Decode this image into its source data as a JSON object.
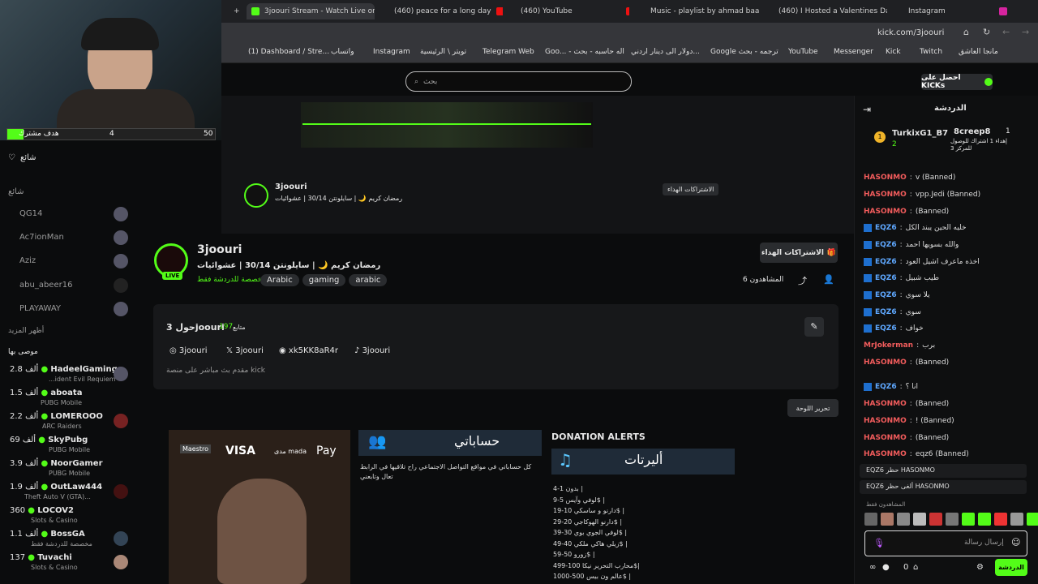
{
  "browser": {
    "tabs": [
      {
        "label": "3joouri Stream - Watch Live on"
      },
      {
        "label": "(460) peace for a long day"
      },
      {
        "label": "(460) YouTube"
      },
      {
        "label": "Music - playlist by ahmad baa"
      },
      {
        "label": "(460) I Hosted a Valentines Dat"
      },
      {
        "label": "Instagram"
      }
    ],
    "url": "kick.com/3joouri",
    "bookmarks": [
      "(1) Dashboard / Stre...",
      "واتساب",
      "Instagram",
      "تويتر \\ الرئيسية",
      "Telegram Web",
      "Goo... - اله حاسبه - بحث",
      "دولار الى دينار اردني...",
      "Google ترجمه - بحث",
      "YouTube",
      "Messenger",
      "Kick",
      "Twitch",
      "مانجا العاشق"
    ]
  },
  "header": {
    "search_placeholder": "بحث",
    "get_kicks": "احصل على KICKs"
  },
  "goal": {
    "label": "هدف مشترك",
    "current": "4",
    "target": "50"
  },
  "sidebar": {
    "follow_label": "شائع",
    "following_title": "شائع",
    "followed": [
      "QG14",
      "Ac7ionMan",
      "Aziz",
      "abu_abeer16",
      "PLAYAWAY"
    ],
    "show_more": "أظهر المزيد",
    "recommended_title": "موصى بها",
    "recommended": [
      {
        "name": "HadeelGaming",
        "game": "...ident Evil Requiem",
        "viewers": "2.8 ألف"
      },
      {
        "name": "aboata",
        "game": "PUBG Mobile",
        "viewers": "1.5 ألف"
      },
      {
        "name": "LOMEROOO",
        "game": "ARC Raiders",
        "viewers": "2.2 ألف"
      },
      {
        "name": "SkyPubg",
        "game": "PUBG Mobile",
        "viewers": "69 ألف"
      },
      {
        "name": "NoorGamer",
        "game": "PUBG Mobile",
        "viewers": "3.9 ألف"
      },
      {
        "name": "OutLaw444",
        "game": "Theft Auto V (GTA)...",
        "viewers": "1.9 ألف"
      },
      {
        "name": "LOCOV2",
        "game": "Slots & Casino",
        "viewers": "360"
      },
      {
        "name": "BossGA",
        "game": "مخصصة للدردشة فقط",
        "viewers": "1.1 ألف"
      },
      {
        "name": "Tuvachi",
        "game": "Slots & Casino",
        "viewers": "137"
      }
    ]
  },
  "stream": {
    "name": "3joouri",
    "title": "رمضان كريم 🌙 | سايلونتن 30/14 | عشوائيات",
    "category": "مخصصة للدردشة فقط",
    "tags": [
      "Arabic",
      "gaming",
      "arabic"
    ],
    "gift_button": "الاشتراكات الهداء",
    "viewers": "المشاهدون 6",
    "live": "LIVE"
  },
  "about": {
    "title": "حول 3joouri",
    "followers_count": "197",
    "followers_label": "متابع",
    "socials": [
      "3joouri",
      "3joouri",
      "xk5KK8aR4r",
      "3joouri"
    ],
    "bio": "مقدم بث مباشر على منصة kick",
    "edit_panels": "تحرير اللوحة"
  },
  "panels": {
    "accounts_title": "حساباتي",
    "accounts_text": "كل حساباتي في مواقع التواصل الاجتماعي راح تلاقيها في الرابط تعال وتابعني",
    "alerts_title": "DONATION ALERTS",
    "alerts_banner": "أليرتات",
    "alerts": [
      "بدون 1-4 |",
      "لوفي وآيس 5-9$ |",
      "دارنو و ساسكي 10-19$ |",
      "دارنو الهوكاجي 20-29$ |",
      "لوفي الجوي بوي 30-39$ |",
      "زيلي هاكي ملكي 40-49$ |",
      "زورو 50-59$ |",
      "محارب التحرير نيكا 100-499$|",
      "عالم ون بيس 500-1000$ |"
    ],
    "card_brands": [
      "Maestro",
      "VISA",
      "مدى mada",
      "Pay"
    ]
  },
  "chat": {
    "title": "الدردشة",
    "top": [
      {
        "name": "TurkixG1_B7",
        "rank": "1",
        "count": "2"
      },
      {
        "name": "8creep8",
        "rank": "1",
        "note": "إهداء 1 اشتراك للوصول للمركز 3"
      }
    ],
    "messages": [
      {
        "user": "HASONMO",
        "text": "v (Banned)",
        "type": "red"
      },
      {
        "user": "HASONMO",
        "text": "vpp.Jedi (Banned)",
        "type": "red"
      },
      {
        "user": "HASONMO",
        "text": "(Banned)",
        "type": "red"
      },
      {
        "user": "EQZ6",
        "text": "خليه الحين يبند الكل",
        "type": "blue"
      },
      {
        "user": "EQZ6",
        "text": "والله بسويها احمد",
        "type": "blue"
      },
      {
        "user": "EQZ6",
        "text": "اخذه ماعرف اشيل العود",
        "type": "blue"
      },
      {
        "user": "EQZ6",
        "text": "طيب شبيل",
        "type": "blue"
      },
      {
        "user": "EQZ6",
        "text": "يلا سوي",
        "type": "blue"
      },
      {
        "user": "EQZ6",
        "text": "سوي",
        "type": "blue"
      },
      {
        "user": "EQZ6",
        "text": "خواف",
        "type": "blue"
      },
      {
        "user": "MrJokerman",
        "text": "برب",
        "type": "red"
      },
      {
        "user": "HASONMO",
        "text": "(Banned)",
        "type": "red"
      },
      {
        "user": "EQZ6",
        "text": "انا ؟",
        "type": "blue"
      },
      {
        "user": "HASONMO",
        "text": "(Banned)",
        "type": "red"
      },
      {
        "user": "HASONMO",
        "text": "! (Banned)",
        "type": "red"
      },
      {
        "user": "HASONMO",
        "text": "(Banned)",
        "type": "red"
      },
      {
        "user": "HASONMO",
        "text": "eqz6 (Banned)",
        "type": "red"
      }
    ],
    "ban1": "EQZ6 حظر HASONMO",
    "ban2": "EQZ6 ألغى حظر HASONMO",
    "viewers_label": "المشاهدون فقط",
    "input_placeholder": "إرسال رسالة",
    "points": "0",
    "send": "الدردشة"
  },
  "colors": {
    "accent": "#53fc18",
    "bg": "#0b0c0d"
  }
}
